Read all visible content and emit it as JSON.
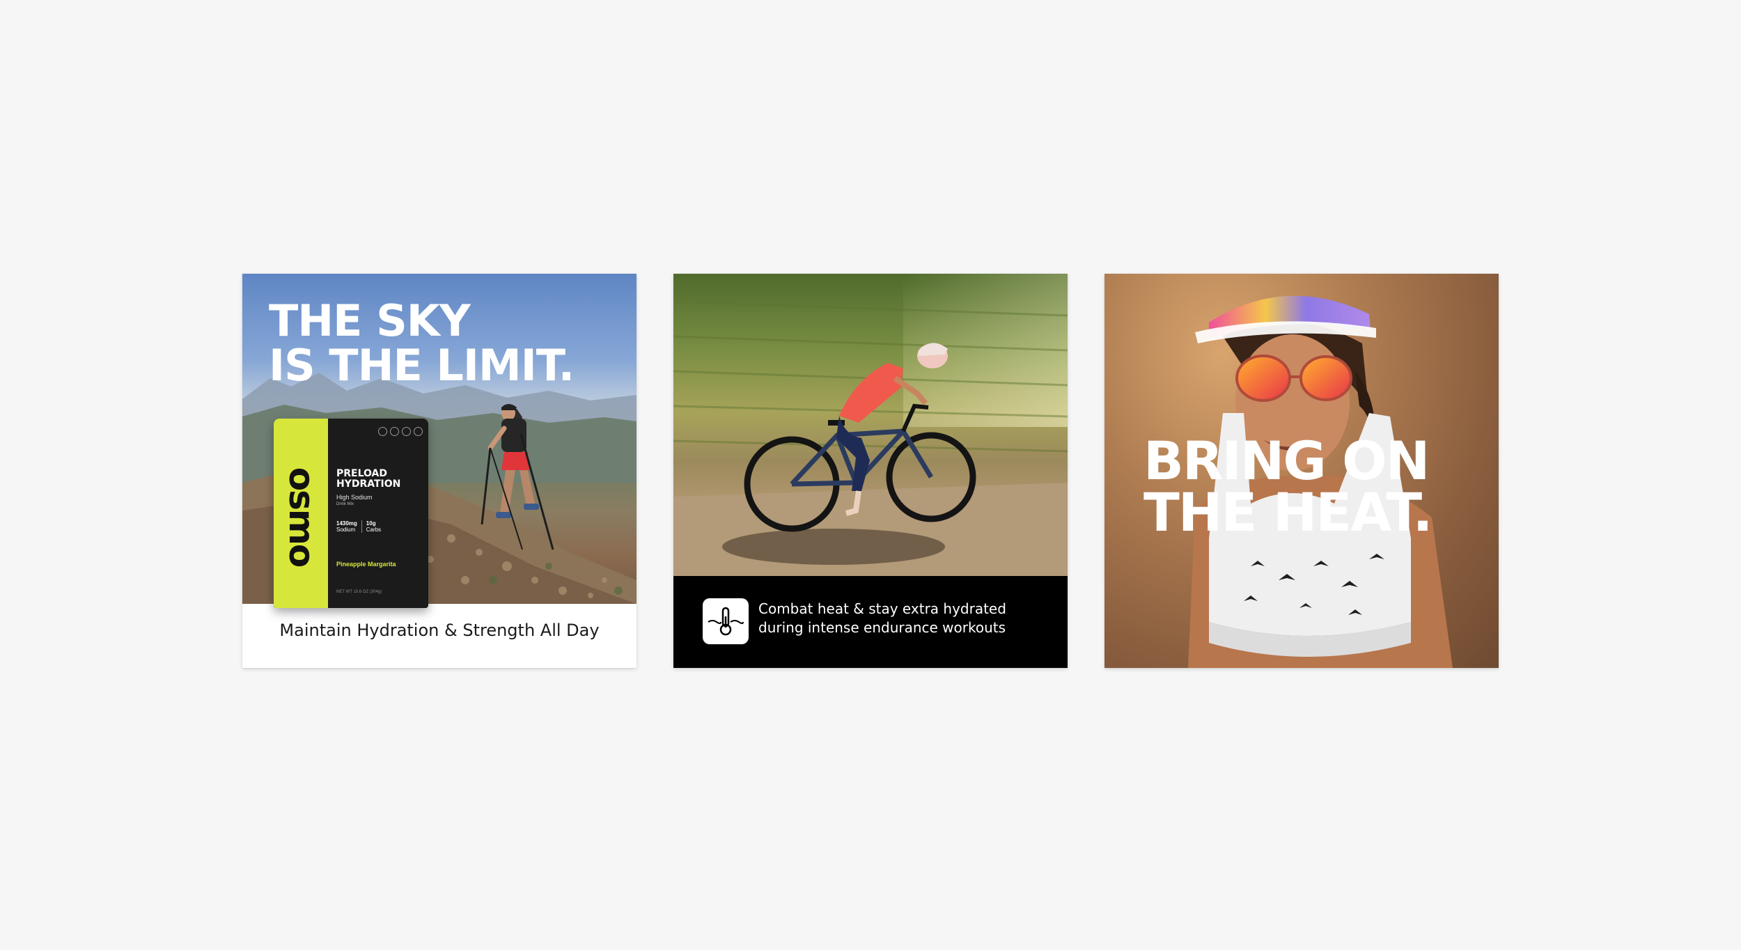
{
  "cards": [
    {
      "headline": [
        "THE SKY",
        "IS THE LIMIT."
      ],
      "caption": "Maintain Hydration & Strength All Day",
      "product": {
        "brand": "osmo",
        "title": [
          "PRELOAD",
          "HYDRATION"
        ],
        "subtitle": "High Sodium",
        "subtitle_small": "Drink Mix",
        "stats": [
          {
            "value": "1430mg",
            "label": "Sodium"
          },
          {
            "value": "10g",
            "label": "Carbs"
          }
        ],
        "flavor": "Pineapple Margarita",
        "net_weight": "NET WT 10.6 OZ (304g)"
      }
    },
    {
      "caption_lines": [
        "Combat heat & stay extra hydrated",
        "during intense endurance workouts"
      ],
      "icon": "thermometer-heat-icon"
    },
    {
      "headline": [
        "BRING ON",
        "THE HEAT."
      ]
    }
  ],
  "colors": {
    "background": "#f6f6f6",
    "lime": "#d7e63a",
    "black": "#000000",
    "white": "#ffffff"
  }
}
